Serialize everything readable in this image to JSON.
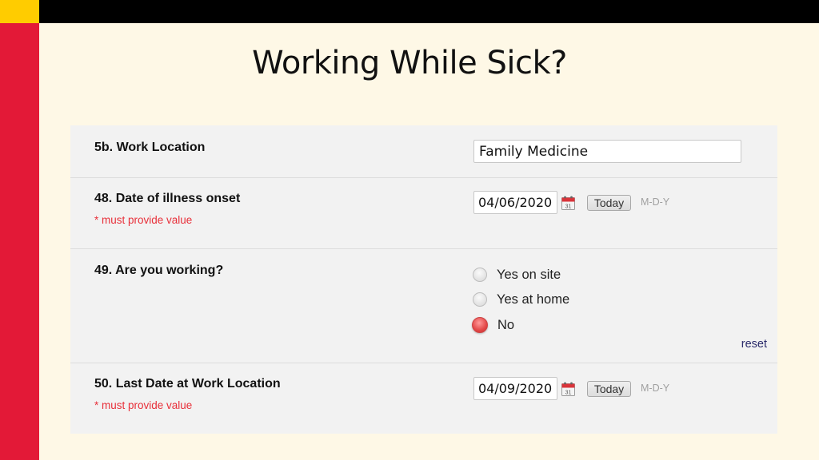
{
  "slide": {
    "title": "Working While Sick?",
    "colors": {
      "background": "#fef8e6",
      "top_bar": "#000000",
      "corner_accent": "#ffcc00",
      "left_bar": "#e31937"
    }
  },
  "form": {
    "rows": [
      {
        "label": "5b. Work Location",
        "field_type": "text",
        "value": "Family Medicine"
      },
      {
        "label": "48. Date of illness onset",
        "required_note": "* must provide value",
        "field_type": "date",
        "value": "04/06/2020",
        "icon": "calendar-icon",
        "today_label": "Today",
        "format_hint": "M-D-Y"
      },
      {
        "label": "49. Are you working?",
        "field_type": "radio",
        "options": [
          {
            "label": "Yes on site",
            "checked": false
          },
          {
            "label": "Yes at home",
            "checked": false
          },
          {
            "label": "No",
            "checked": true
          }
        ],
        "reset_label": "reset"
      },
      {
        "label": "50. Last Date at Work Location",
        "required_note": "* must provide value",
        "field_type": "date",
        "value": "04/09/2020",
        "icon": "calendar-icon",
        "today_label": "Today",
        "format_hint": "M-D-Y"
      }
    ],
    "colors": {
      "required_text": "#e8303a",
      "radio_checked": "#e34848",
      "reset_link": "#2a2a6a",
      "format_hint": "#a0a0a0"
    }
  }
}
